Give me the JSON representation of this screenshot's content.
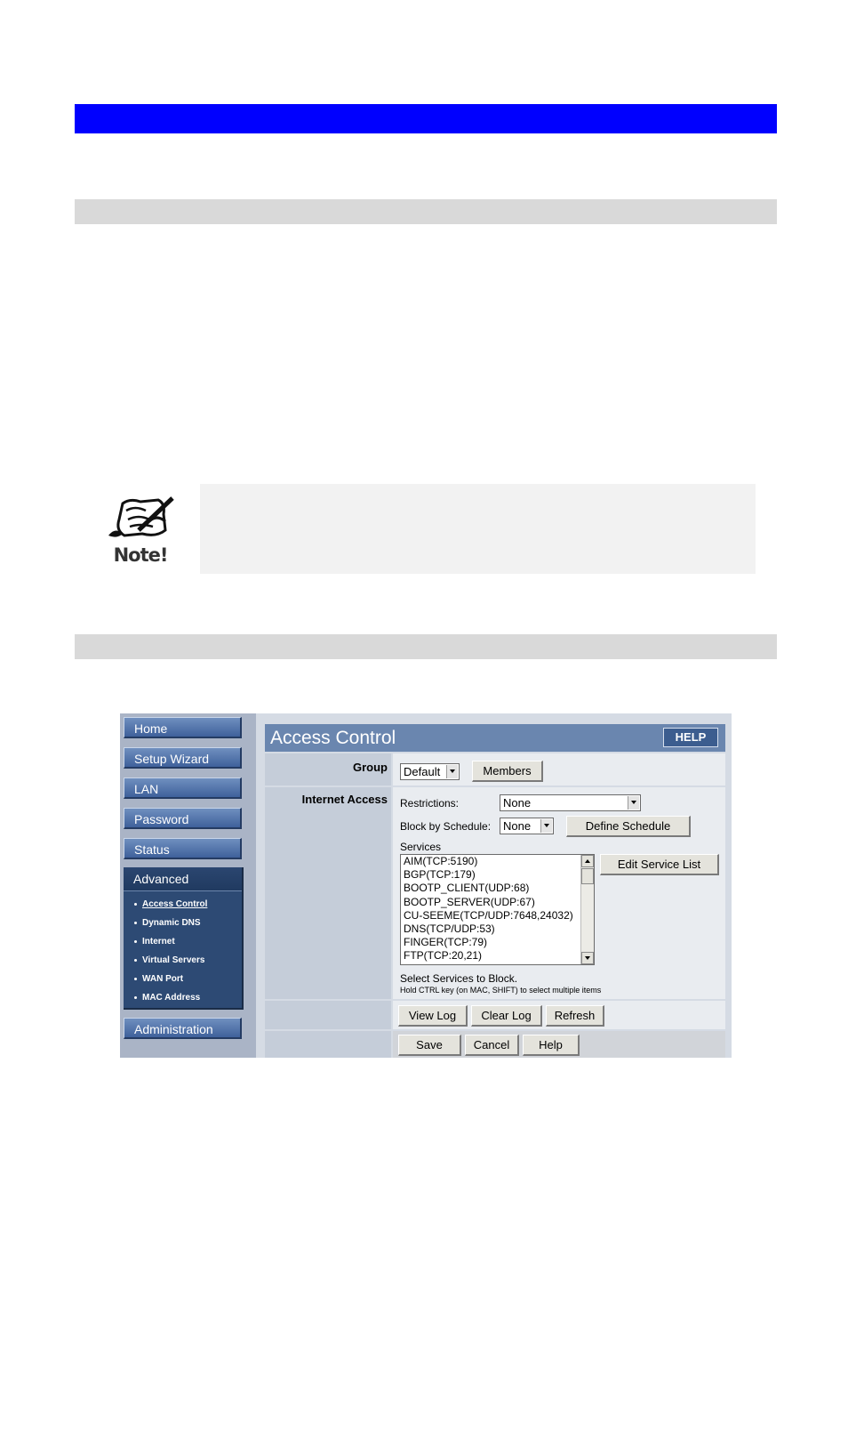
{
  "note": {
    "label": "Note!"
  },
  "sidebar": {
    "items": [
      {
        "label": "Home"
      },
      {
        "label": "Setup Wizard"
      },
      {
        "label": "LAN"
      },
      {
        "label": "Password"
      },
      {
        "label": "Status"
      }
    ],
    "advanced": {
      "label": "Advanced",
      "subitems": [
        {
          "label": "Access Control"
        },
        {
          "label": "Dynamic DNS"
        },
        {
          "label": "Internet"
        },
        {
          "label": "Virtual Servers"
        },
        {
          "label": "WAN Port"
        },
        {
          "label": "MAC Address"
        }
      ]
    },
    "administration": {
      "label": "Administration"
    }
  },
  "page": {
    "title": "Access Control",
    "help_label": "HELP",
    "group": {
      "label": "Group",
      "value": "Default",
      "members_label": "Members"
    },
    "internet_access": {
      "label": "Internet Access",
      "restrictions_label": "Restrictions:",
      "restrictions_value": "None",
      "schedule_label": "Block by Schedule:",
      "schedule_value": "None",
      "define_schedule_label": "Define Schedule",
      "services_label": "Services",
      "services": [
        "AIM(TCP:5190)",
        "BGP(TCP:179)",
        "BOOTP_CLIENT(UDP:68)",
        "BOOTP_SERVER(UDP:67)",
        "CU-SEEME(TCP/UDP:7648,24032)",
        "DNS(TCP/UDP:53)",
        "FINGER(TCP:79)",
        "FTP(TCP:20,21)"
      ],
      "edit_service_list_label": "Edit Service List",
      "hint_main": "Select Services to Block.",
      "hint_sub": "Hold CTRL key (on MAC, SHIFT) to select multiple items"
    },
    "log_buttons": {
      "view": "View Log",
      "clear": "Clear Log",
      "refresh": "Refresh"
    },
    "actions": {
      "save": "Save",
      "cancel": "Cancel",
      "help": "Help"
    }
  }
}
